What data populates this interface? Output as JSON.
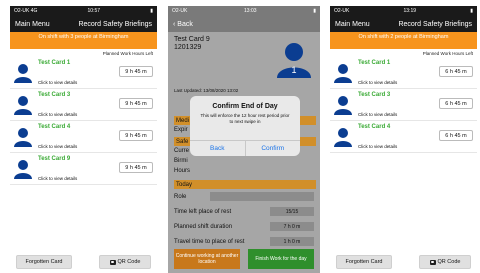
{
  "phone1": {
    "status": {
      "carrier": "O2-UK 4G",
      "time": "10:57"
    },
    "nav": {
      "left": "Main Menu",
      "right": "Record Safety Briefings"
    },
    "banner": "On shift with 3 people at Birmingham",
    "planned_label": "Planned Work Hours Left",
    "cards": [
      {
        "title": "Test Card 1",
        "time": "9 h 45 m",
        "detail": "Click to view details"
      },
      {
        "title": "Test Card 3",
        "time": "9 h 45 m",
        "detail": "Click to view details"
      },
      {
        "title": "Test Card 4",
        "time": "9 h 45 m",
        "detail": "Click to view details"
      },
      {
        "title": "Test Card 9",
        "time": "9 h 45 m",
        "detail": "Click to view details"
      }
    ],
    "buttons": {
      "forgotten": "Forgotten Card",
      "qr": "QR Code"
    }
  },
  "phone2": {
    "status": {
      "carrier": "O2-UK",
      "time": "13:03"
    },
    "nav": {
      "back": "Back"
    },
    "card_title": "Test Card 9",
    "card_number": "1201329",
    "avatar_number": "1",
    "last_updated": "Last Updated: 13/08/2020 13:02",
    "rows": [
      {
        "label": "Medi"
      },
      {
        "label": "Expir"
      },
      {
        "label": "Safe"
      },
      {
        "label": "Curre"
      },
      {
        "label": "Birmi"
      },
      {
        "label": "Hours"
      },
      {
        "label": "Today"
      },
      {
        "label": "Role"
      }
    ],
    "fields": [
      {
        "label": "Time left place of rest",
        "value": "15/15"
      },
      {
        "label": "Planned shift duration",
        "value": "7 h 0 m"
      },
      {
        "label": "Travel time to place of rest",
        "value": "1 h 0 m"
      }
    ],
    "dialog": {
      "title": "Confirm End of Day",
      "message": "This will enforce the 12 hour rest period prior to next swipe in",
      "back": "Back",
      "confirm": "Confirm"
    },
    "buttons": {
      "continue": "Continue working at another location",
      "finish": "Finish Work for the day"
    }
  },
  "phone3": {
    "status": {
      "carrier": "O2-UK",
      "time": "13:19"
    },
    "nav": {
      "left": "Main Menu",
      "right": "Record Safety Briefings"
    },
    "banner": "On shift with 2 people at Birmingham",
    "planned_label": "Planned Work Hours Left",
    "cards": [
      {
        "title": "Test Card 1",
        "time": "6 h 45 m",
        "detail": "Click to view details"
      },
      {
        "title": "Test Card 3",
        "time": "6 h 45 m",
        "detail": "Click to view details"
      },
      {
        "title": "Test Card 4",
        "time": "6 h 45 m",
        "detail": "Click to view details"
      }
    ],
    "buttons": {
      "forgotten": "Forgotten Card",
      "qr": "QR Code"
    }
  },
  "colors": {
    "accent_orange": "#f7941d",
    "card_title_green": "#3aaa35",
    "navbar": "#1a1a1a",
    "avatar_blue": "#0b3d91"
  }
}
